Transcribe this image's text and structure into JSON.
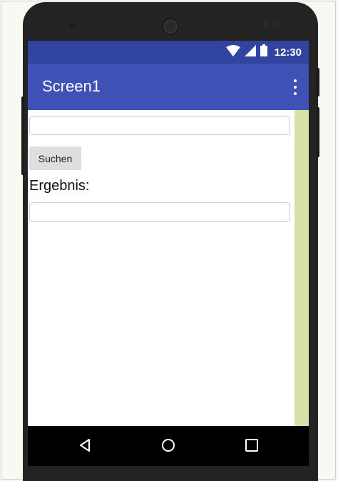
{
  "status_bar": {
    "time": "12:30",
    "icons": [
      "wifi-icon",
      "signal-icon",
      "battery-icon"
    ],
    "color": "#3044a0"
  },
  "app_bar": {
    "title": "Screen1",
    "menu_icon": "overflow-menu-icon",
    "color": "#3f51b5"
  },
  "form": {
    "search_input_value": "",
    "search_button_label": "Suchen",
    "result_label": "Ergebnis:",
    "result_input_value": ""
  },
  "nav_bar": {
    "icons": [
      "back-icon",
      "home-icon",
      "recents-icon"
    ]
  },
  "colors": {
    "side_strip": "#d6e2a9",
    "button_bg": "#dedede"
  }
}
